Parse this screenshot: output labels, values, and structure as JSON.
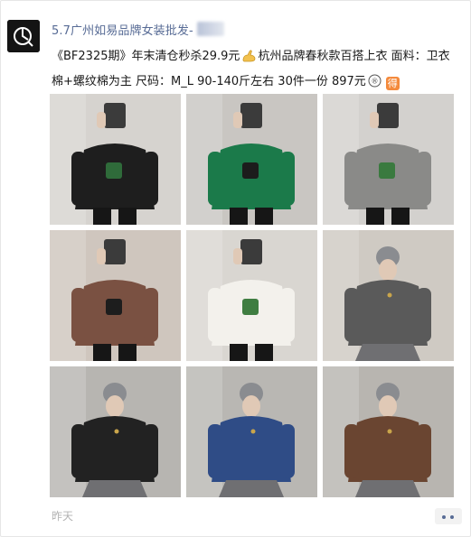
{
  "post": {
    "author_name": "5.7广州如易品牌女装批发-",
    "text_part1": "《BF2325期》年末清仓秒杀29.9元",
    "text_part2": "杭州品牌春秋款百搭上衣  面料：卫衣棉+螺纹棉为主 尺码：M_L  90-140斤左右 30件一份 897元",
    "emoji_registered": "®",
    "emoji_de": "得",
    "time": "昨天"
  },
  "photos": [
    {
      "sweater": "#1e1e1e",
      "bg": "#d6d3cf",
      "accent": "#2f6b3a"
    },
    {
      "sweater": "#1b7a4a",
      "bg": "#c9c6c2",
      "accent": "#1c1c1c"
    },
    {
      "sweater": "#8a8a88",
      "bg": "#d3d1ce",
      "accent": "#3a7a3f"
    },
    {
      "sweater": "#7a5142",
      "bg": "#cfc6be",
      "accent": "#1d1d1d"
    },
    {
      "sweater": "#f3f1ec",
      "bg": "#d9d6d1",
      "accent": "#3f7d41"
    },
    {
      "sweater": "#5a5a5a",
      "bg": "#cfcac3",
      "accent": "#6f4b3b"
    },
    {
      "sweater": "#222222",
      "bg": "#b7b5b1",
      "accent": "#7a5a45"
    },
    {
      "sweater": "#2f4c86",
      "bg": "#b9b7b3",
      "accent": "#7e7e80"
    },
    {
      "sweater": "#6a4531",
      "bg": "#b8b5b0",
      "accent": "#7e7e80"
    }
  ],
  "colors": {
    "link": "#576b95",
    "text": "#191919",
    "time": "#b2b2b2"
  }
}
